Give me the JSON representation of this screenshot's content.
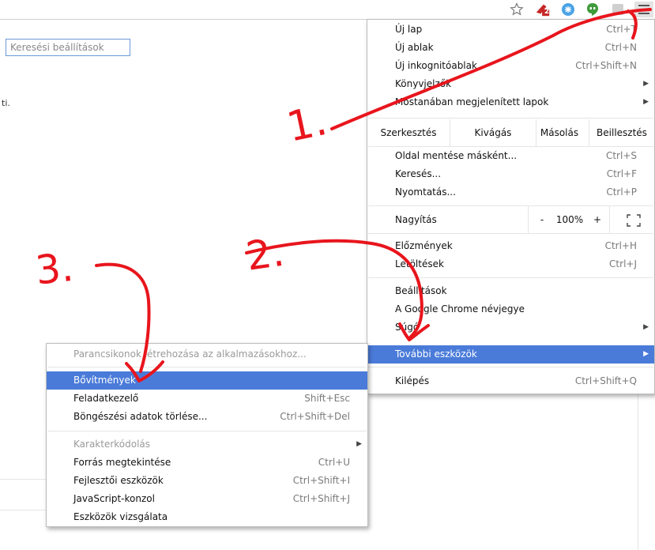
{
  "toolbar": {
    "icons": [
      "star-icon",
      "extension-badge-icon",
      "extension-network-icon",
      "hangouts-icon",
      "extension-gray-icon",
      "chrome-menu-icon"
    ],
    "badge_count": "2"
  },
  "page": {
    "search_placeholder": "Keresési beállítások",
    "left_text": "ti."
  },
  "main_menu": {
    "items_top": [
      {
        "label": "Új lap",
        "shortcut": "Ctrl+T"
      },
      {
        "label": "Új ablak",
        "shortcut": "Ctrl+N"
      },
      {
        "label": "Új inkognitóablak",
        "shortcut": "Ctrl+Shift+N"
      },
      {
        "label": "Könyvjelzők",
        "shortcut": ""
      },
      {
        "label": "Mostanában megjelenített lapok",
        "shortcut": ""
      }
    ],
    "edit": {
      "label": "Szerkesztés",
      "cut": "Kivágás",
      "copy": "Másolás",
      "paste": "Beillesztés"
    },
    "items_file": [
      {
        "label": "Oldal mentése másként...",
        "shortcut": "Ctrl+S"
      },
      {
        "label": "Keresés...",
        "shortcut": "Ctrl+F"
      },
      {
        "label": "Nyomtatás...",
        "shortcut": "Ctrl+P"
      }
    ],
    "zoom": {
      "label": "Nagyítás",
      "minus": "-",
      "value": "100%",
      "plus": "+"
    },
    "items_history": [
      {
        "label": "Előzmények",
        "shortcut": "Ctrl+H"
      },
      {
        "label": "Letöltések",
        "shortcut": "Ctrl+J"
      }
    ],
    "items_settings": [
      {
        "label": "Beállítások"
      },
      {
        "label": "A Google Chrome névjegye"
      },
      {
        "label": "Súgó"
      }
    ],
    "more_tools": "További eszközök",
    "exit": {
      "label": "Kilépés",
      "shortcut": "Ctrl+Shift+Q"
    }
  },
  "sub_menu": {
    "items_a": [
      {
        "label": "Parancsikonok létrehozása az alkalmazásokhoz...",
        "shortcut": "",
        "disabled": true
      },
      {
        "label": "Bővítmények",
        "shortcut": "",
        "selected": true
      },
      {
        "label": "Feladatkezelő",
        "shortcut": "Shift+Esc"
      },
      {
        "label": "Böngészési adatok törlése...",
        "shortcut": "Ctrl+Shift+Del"
      }
    ],
    "items_b": [
      {
        "label": "Karakterkódolás",
        "shortcut": "",
        "disabled": true
      },
      {
        "label": "Forrás megtekintése",
        "shortcut": "Ctrl+U"
      },
      {
        "label": "Fejlesztői eszközök",
        "shortcut": "Ctrl+Shift+I"
      },
      {
        "label": "JavaScript-konzol",
        "shortcut": "Ctrl+Shift+J"
      },
      {
        "label": "Eszközök vizsgálata",
        "shortcut": ""
      }
    ]
  },
  "annotations": {
    "step1": "1.",
    "step2": "2.",
    "step3": "3."
  },
  "colors": {
    "highlight": "#4a7bd9",
    "annotation_red": "#e8151d",
    "search_border": "#6a9ad8"
  }
}
